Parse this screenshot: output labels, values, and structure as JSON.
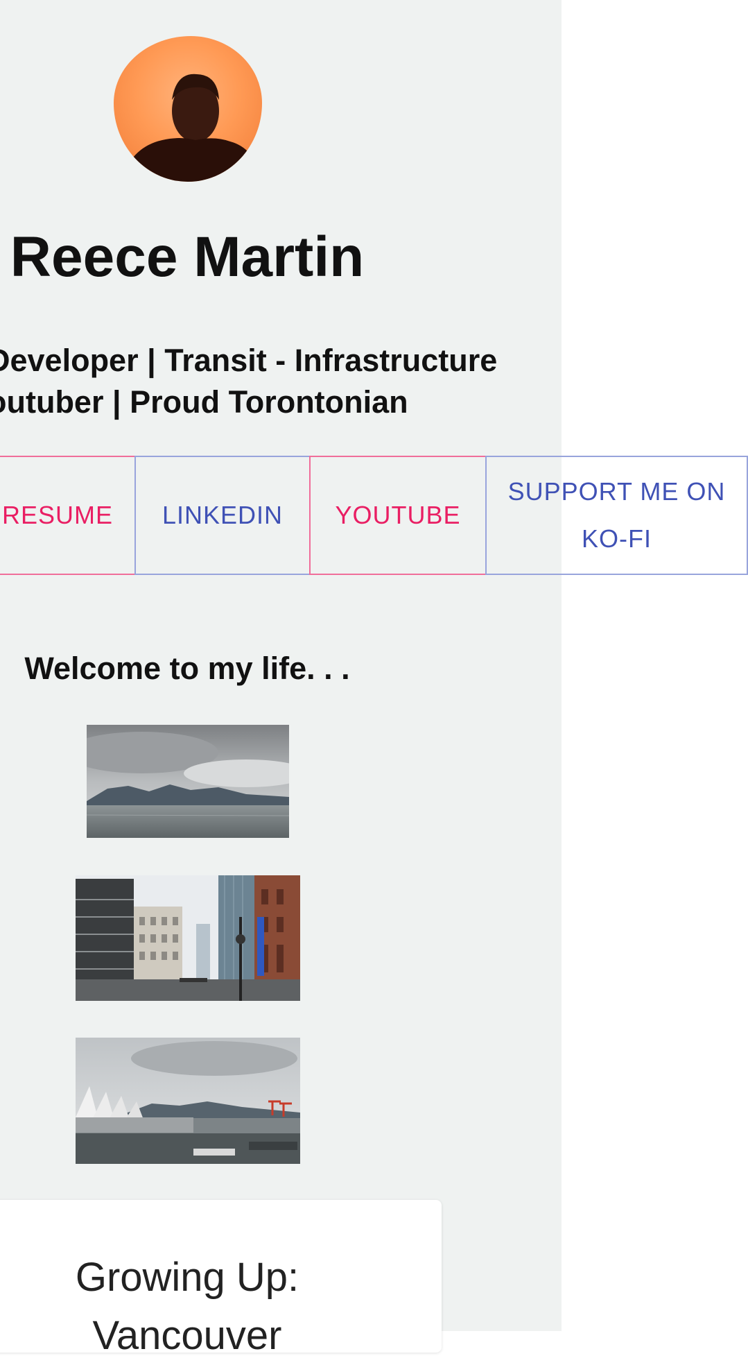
{
  "profile": {
    "name": "Reece Martin",
    "tagline_line1": "Developer | Transit - Infrastructure",
    "tagline_line2": "outuber | Proud Torontonian"
  },
  "links": [
    {
      "label": "RESUME",
      "style": "pink"
    },
    {
      "label": "LINKEDIN",
      "style": "blue"
    },
    {
      "label": "YOUTUBE",
      "style": "pink"
    },
    {
      "label": "SUPPORT ME ON KO-FI",
      "style": "blue"
    }
  ],
  "gallery": {
    "heading": "Welcome to my life. . .",
    "photos": [
      "harbour-clouds-photo",
      "city-street-photo",
      "waterfront-sails-photo"
    ]
  },
  "card": {
    "title": "Growing Up: Vancouver"
  },
  "colors": {
    "background": "#eff2f1",
    "accent_pink": "#e91e63",
    "accent_blue": "#3f51b5",
    "avatar_orange": "#ff9a55"
  }
}
